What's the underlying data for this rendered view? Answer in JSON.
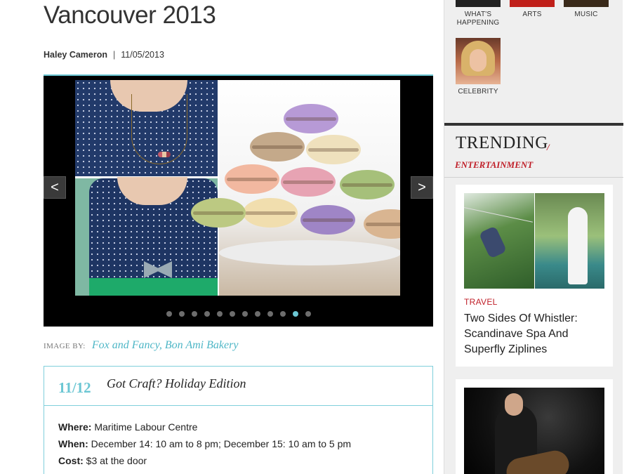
{
  "article": {
    "title": "Vancouver 2013",
    "author": "Haley Cameron",
    "separator": "|",
    "date": "11/05/2013"
  },
  "gallery": {
    "prev_label": "<",
    "next_label": ">",
    "dot_count": 12,
    "active_dot": 11
  },
  "credit": {
    "label": "IMAGE BY:",
    "sources": "Fox and Fancy, Bon Ami Bakery"
  },
  "event": {
    "date": "11/12",
    "name": "Got Craft? Holiday Edition",
    "where_label": "Where:",
    "where_value": "Maritime Labour Centre",
    "when_label": "When:",
    "when_value": "December 14: 10 am to 8 pm; December 15: 10 am to 5 pm",
    "cost_label": "Cost:",
    "cost_value": "$3 at the door"
  },
  "sidebar": {
    "categories": [
      {
        "label_line1": "WHAT'S",
        "label_line2": "HAPPENING"
      },
      {
        "label_line1": "ARTS",
        "label_line2": ""
      },
      {
        "label_line1": "MUSIC",
        "label_line2": ""
      },
      {
        "label_line1": "CELEBRITY",
        "label_line2": ""
      }
    ],
    "trending": {
      "title": "TRENDING",
      "slash": "/",
      "subtitle": "ENTERTAINMENT",
      "cards": [
        {
          "category": "TRAVEL",
          "headline": "Two Sides Of Whistler: Scandinave Spa And Superfly Ziplines"
        }
      ]
    }
  },
  "colors": {
    "accent_teal": "#6bc6d3",
    "accent_red": "#c0202a"
  }
}
